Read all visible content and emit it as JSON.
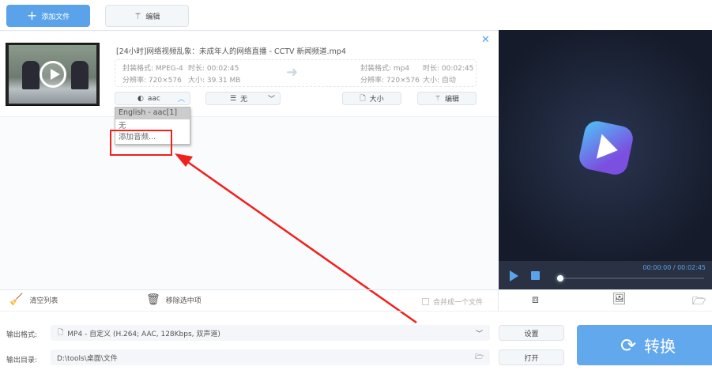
{
  "toolbar": {
    "add_file": "添加文件",
    "edit": "编辑"
  },
  "file": {
    "name": "[24小时]网络视频乱象：未成年人的网络直播 - CCTV 新闻频道.mp4",
    "src": {
      "format": "封装格式: MPEG-4",
      "duration": "时长: 00:02:45",
      "resolution": "分辨率: 720×576",
      "size": "大小: 39.31 MB"
    },
    "dst": {
      "format": "封装格式: mp4",
      "duration": "时长: 00:02:45",
      "resolution": "分辨率: 720×576",
      "size": "大小: 自动"
    },
    "audio_select": "aac",
    "subtitle_select": "无",
    "size_button": "大小",
    "edit_button": "编辑"
  },
  "audio_dropdown": {
    "items": [
      "English - aac[1]",
      "无",
      "添加音频..."
    ]
  },
  "player": {
    "time": "00:00:00 / 00:02:45",
    "progress": 0
  },
  "bottom_bar": {
    "clear_list": "清空列表",
    "remove_selected": "移除选中项",
    "merge": "合并成一个文件"
  },
  "output": {
    "format_label": "输出格式:",
    "format_value": "MP4 - 自定义 (H.264; AAC, 128Kbps, 双声道)",
    "settings": "设置",
    "dir_label": "输出目录:",
    "dir_value": "D:\\tools\\桌面\\文件",
    "open": "打开",
    "convert": "转换"
  },
  "colors": {
    "accent": "#5aa3ea",
    "annotation": "#f0201c",
    "preview_bg": "#1c2333"
  }
}
